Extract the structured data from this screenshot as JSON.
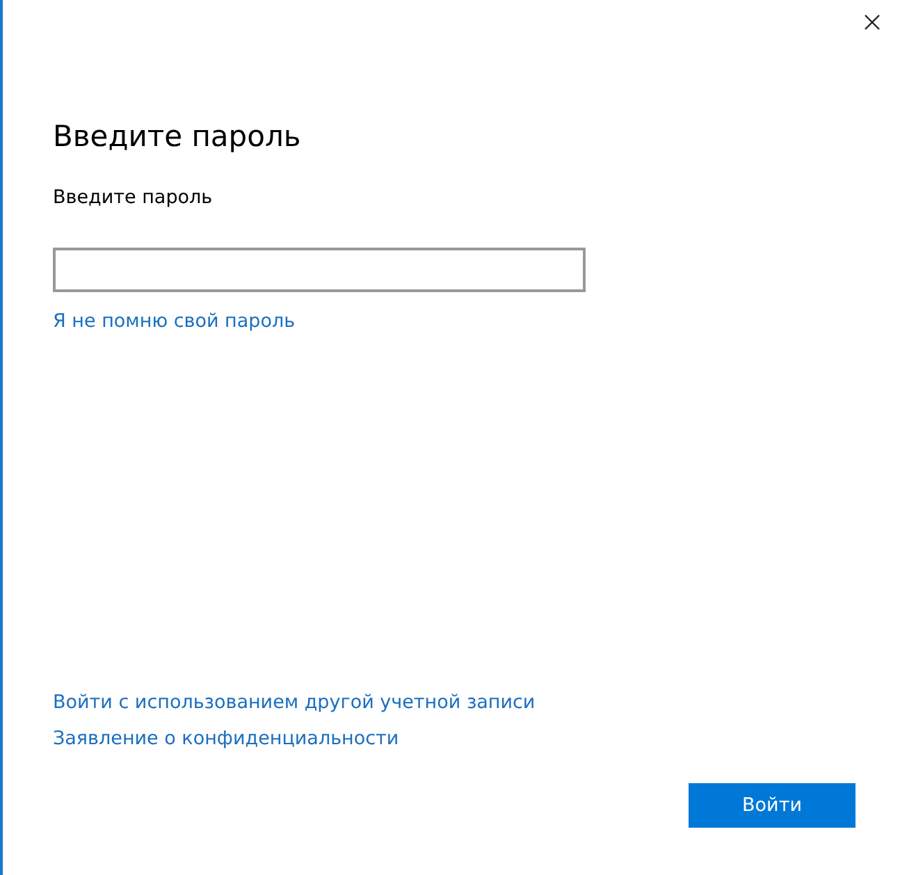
{
  "title": "Введите пароль",
  "password_field": {
    "label": "Введите пароль"
  },
  "forgot_link": "Я не помню свой пароль",
  "links": [
    "Войти с использованием другой учетной записи",
    "Заявление о конфиденциальности"
  ],
  "sign_in_button": "Войти"
}
